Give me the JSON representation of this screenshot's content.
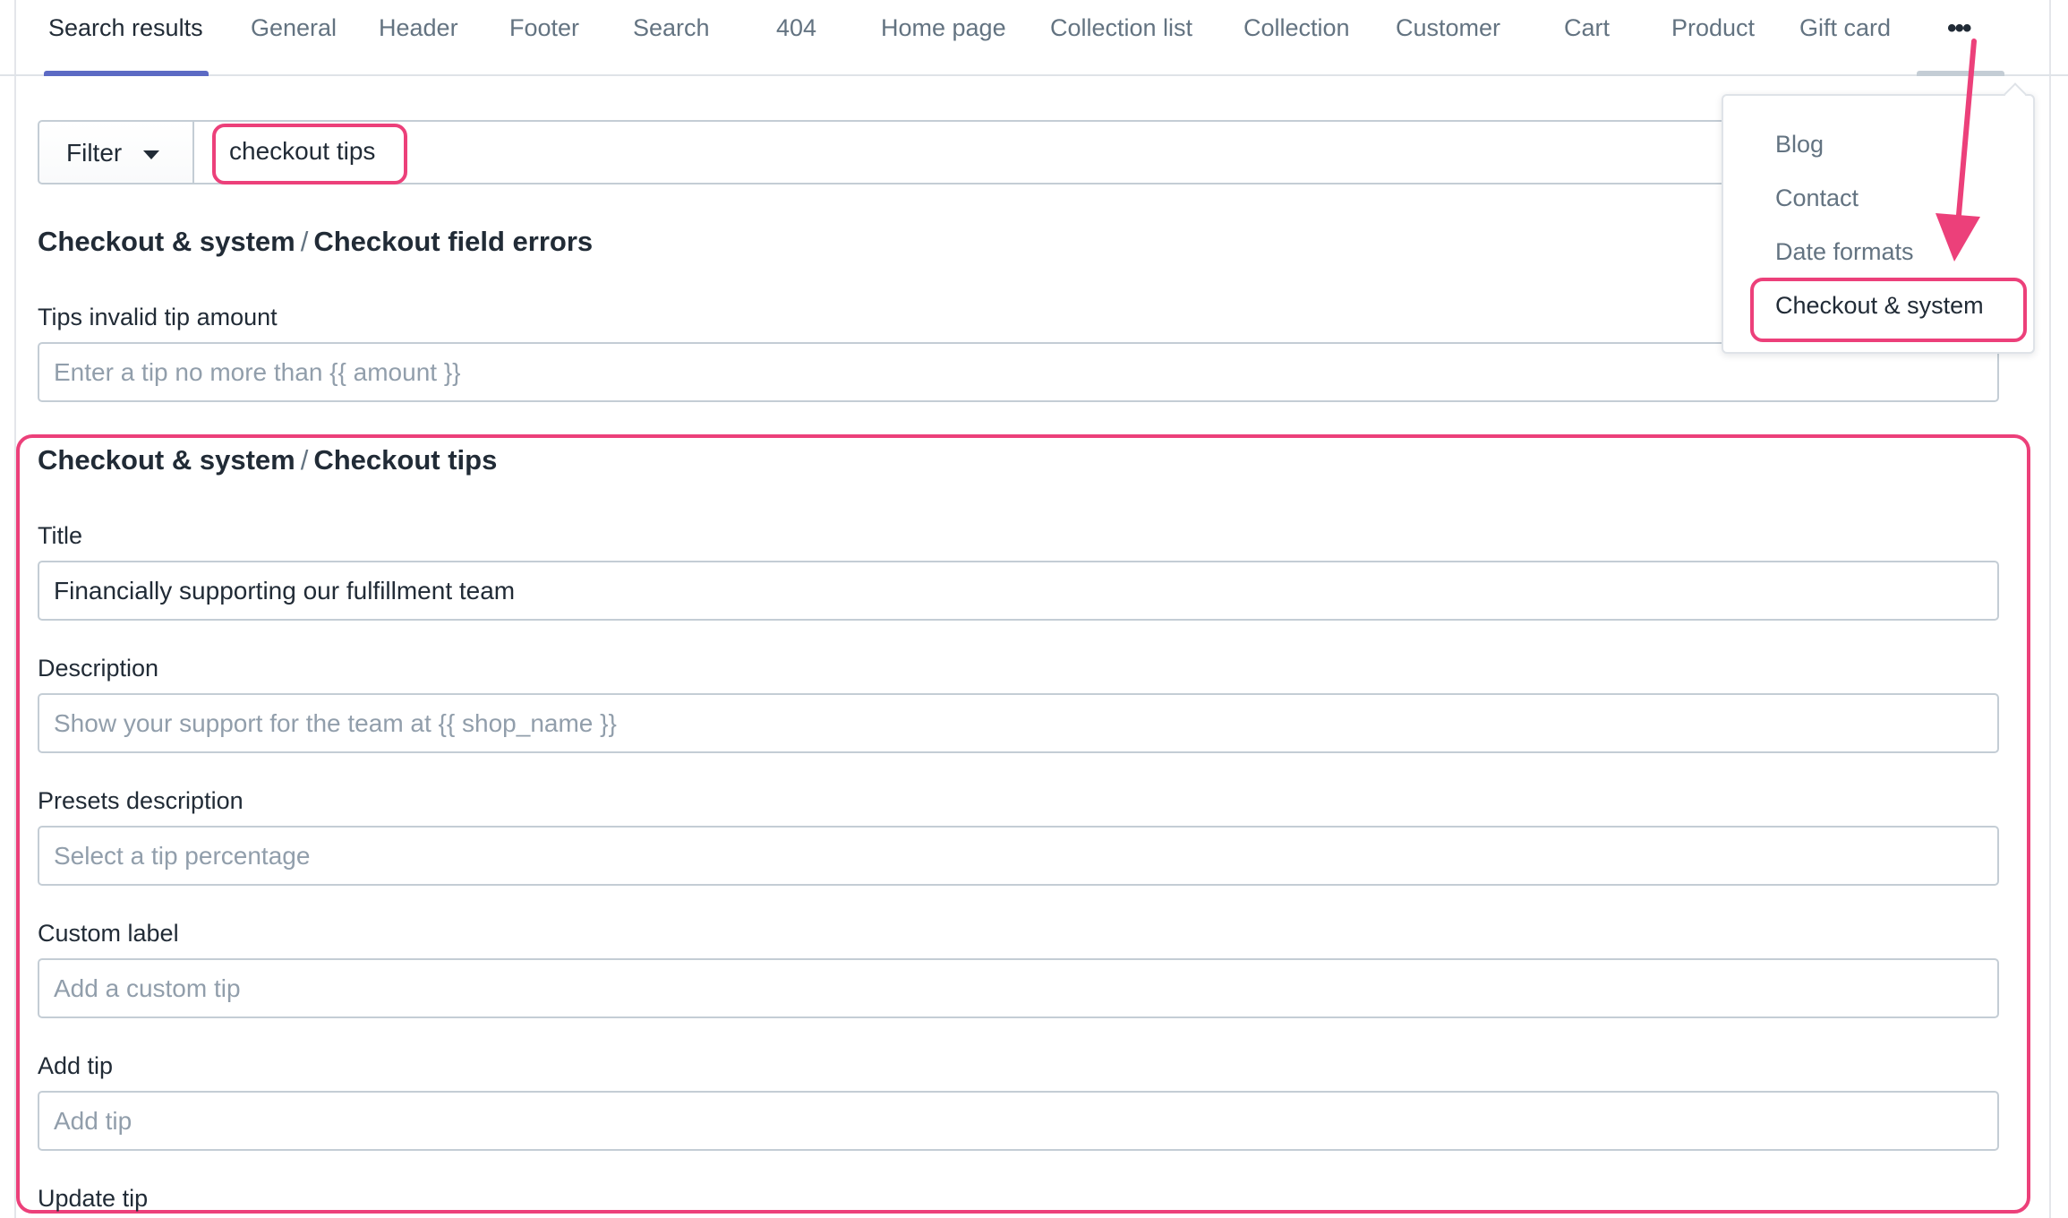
{
  "tabs": [
    {
      "label": "Search results",
      "active": true
    },
    {
      "label": "General"
    },
    {
      "label": "Header"
    },
    {
      "label": "Footer"
    },
    {
      "label": "Search"
    },
    {
      "label": "404"
    },
    {
      "label": "Home page"
    },
    {
      "label": "Collection list"
    },
    {
      "label": "Collection"
    },
    {
      "label": "Customer"
    },
    {
      "label": "Cart"
    },
    {
      "label": "Product"
    },
    {
      "label": "Gift card"
    }
  ],
  "more_tab": {
    "label": "•••",
    "icon": "more-horizontal-icon"
  },
  "filter": {
    "label": "Filter",
    "icon": "caret-down-icon"
  },
  "search": {
    "value": "checkout tips"
  },
  "sections": [
    {
      "group": "Checkout & system",
      "separator": "/",
      "name": "Checkout field errors",
      "fields": [
        {
          "label": "Tips invalid tip amount",
          "value": "",
          "placeholder": "Enter a tip no more than {{ amount }}"
        }
      ]
    },
    {
      "group": "Checkout & system",
      "separator": "/",
      "name": "Checkout tips",
      "fields": [
        {
          "label": "Title",
          "value": "Financially supporting our fulfillment team",
          "placeholder": ""
        },
        {
          "label": "Description",
          "value": "",
          "placeholder": "Show your support for the team at {{ shop_name }}"
        },
        {
          "label": "Presets description",
          "value": "",
          "placeholder": "Select a tip percentage"
        },
        {
          "label": "Custom label",
          "value": "",
          "placeholder": "Add a custom tip"
        },
        {
          "label": "Add tip",
          "value": "",
          "placeholder": "Add tip"
        },
        {
          "label": "Update tip",
          "value": "",
          "placeholder": ""
        }
      ]
    }
  ],
  "more_menu": {
    "items": [
      {
        "label": "Blog"
      },
      {
        "label": "Contact"
      },
      {
        "label": "Date formats"
      },
      {
        "label": "Checkout & system",
        "selected": true
      }
    ]
  },
  "colors": {
    "accent": "#5c6ac4",
    "highlight": "#ec407a",
    "text": "#212b36",
    "muted": "#637381",
    "placeholder": "#919eab",
    "border": "#c4cdd5"
  }
}
